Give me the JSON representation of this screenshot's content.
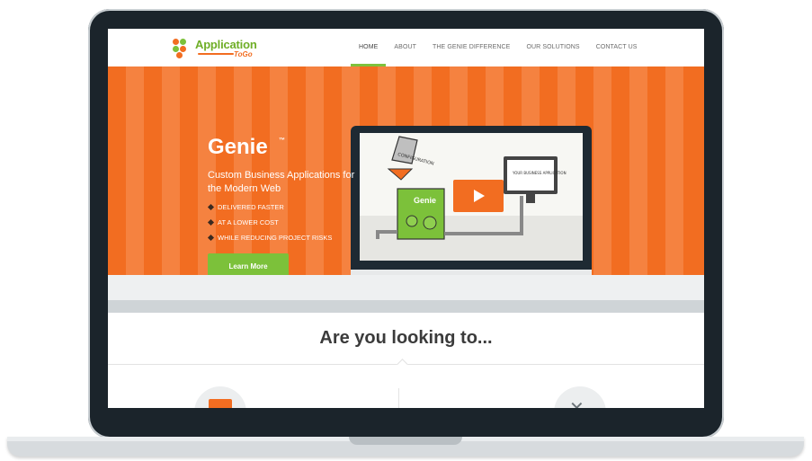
{
  "logo": {
    "text": "Application",
    "sub": "ToGo"
  },
  "nav": {
    "items": [
      "HOME",
      "ABOUT",
      "THE GENIE DIFFERENCE",
      "OUR SOLUTIONS",
      "CONTACT US"
    ],
    "active": "HOME"
  },
  "hero": {
    "title": "Genie",
    "tm": "™",
    "subtitle": "Custom Business Applications for the Modern Web",
    "bullets": [
      "DELIVERED FASTER",
      "AT A LOWER COST",
      "WHILE REDUCING PROJECT RISKS"
    ],
    "cta_label": "Learn More"
  },
  "video": {
    "label_configuration": "CONFIGURATION",
    "label_genie": "Genie",
    "label_result": "YOUR BUSINESS APPLICATION"
  },
  "section": {
    "title": "Are you looking to..."
  },
  "colors": {
    "brand_orange": "#f26d21",
    "brand_green": "#7cc13a",
    "frame": "#1b242b"
  }
}
